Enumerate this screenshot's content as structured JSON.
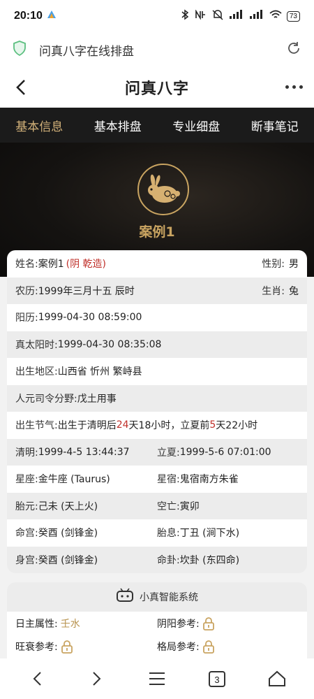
{
  "status": {
    "time": "20:10",
    "battery": "73"
  },
  "browser": {
    "page_title": "问真八字在线排盘"
  },
  "app": {
    "title": "问真八字"
  },
  "tabs": [
    "基本信息",
    "基本排盘",
    "专业细盘",
    "断事笔记"
  ],
  "hero": {
    "case_name": "案例1"
  },
  "info": {
    "name_label": "姓名:",
    "name_value": "案例1",
    "name_note": "(阴 乾造)",
    "gender_label": "性别:",
    "gender_value": "男",
    "lunar_label": "农历:",
    "lunar_value": "1999年三月十五 辰时",
    "zodiac_label": "生肖:",
    "zodiac_value": "兔",
    "solar_label": "阳历:",
    "solar_value": "1999-04-30 08:59:00",
    "true_solar_label": "真太阳时:",
    "true_solar_value": "1999-04-30 08:35:08",
    "place_label": "出生地区:",
    "place_value": "山西省 忻州 繁峙县",
    "siling_label": "人元司令分野:",
    "siling_value": "戊土用事",
    "jieqi_label": "出生节气:",
    "jieqi_a": "出生于清明后",
    "jieqi_days1": "24",
    "jieqi_b": "天18小时，立夏前",
    "jieqi_days2": "5",
    "jieqi_c": "天22小时",
    "qingming_label": "清明:",
    "qingming_value": "1999-4-5 13:44:37",
    "lixia_label": "立夏:",
    "lixia_value": "1999-5-6 07:01:00",
    "xingzuo_label": "星座:",
    "xingzuo_value": "金牛座 (Taurus)",
    "xingxiu_label": "星宿:",
    "xingxiu_value": "鬼宿南方朱雀",
    "taiyuan_label": "胎元:",
    "taiyuan_value": "己未 (天上火)",
    "kongwang_label": "空亡:",
    "kongwang_value": "寅卯",
    "minggong_label": "命宫:",
    "minggong_value": "癸酉 (剑锋金)",
    "taixi_label": "胎息:",
    "taixi_value": "丁丑 (涧下水)",
    "shengong_label": "身宫:",
    "shengong_value": "癸酉 (剑锋金)",
    "minggua_label": "命卦:",
    "minggua_value": "坎卦 (东四命)"
  },
  "smart": {
    "title": "小真智能系统",
    "rizhu_label": "日主属性:",
    "rizhu_value": "壬水",
    "yinyang_label": "阴阳参考:",
    "wangshuai_label": "旺衰参考:",
    "geju_label": "格局参考:"
  },
  "nav": {
    "tab_count": "3"
  },
  "colors": {
    "accent_gold": "#c9a461",
    "highlight_red": "#c0302a",
    "tab_bar": "#1b1b1b"
  }
}
